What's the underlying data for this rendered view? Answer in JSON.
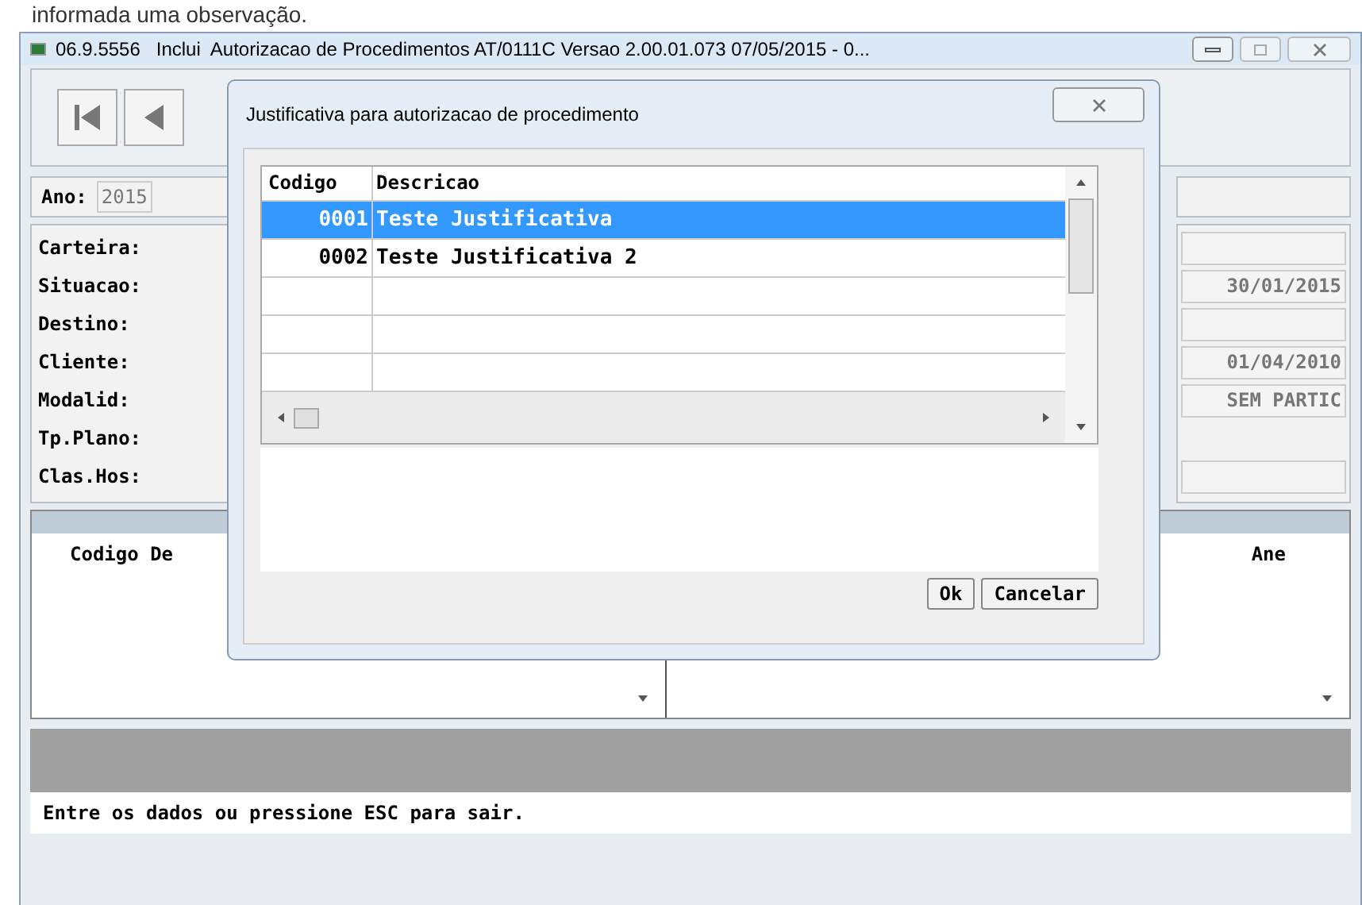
{
  "caption_fragment": "informada uma observação.",
  "window": {
    "title": "06.9.5556   Inclui  Autorizacao de Procedimentos AT/0111C Versao 2.00.01.073 07/05/2015 - 0..."
  },
  "form": {
    "ano_label": "Ano:",
    "ano_value": "2015",
    "rows": [
      {
        "label": "Carteira:",
        "kind": "field"
      },
      {
        "label": "Situacao:",
        "kind": "field",
        "value": "30/01/2015"
      },
      {
        "label": "Destino:",
        "kind": "field"
      },
      {
        "label": "Cliente:",
        "kind": "field",
        "value": "01/04/2010"
      },
      {
        "label": "Modalid:",
        "kind": "field",
        "value": "SEM PARTIC"
      },
      {
        "label": "Tp.Plano:",
        "kind": "label"
      },
      {
        "label": "Clas.Hos:",
        "kind": "field"
      }
    ]
  },
  "lists": {
    "left_header": "Codigo De",
    "right_header": "Ane"
  },
  "status_bar": "Entre os dados ou pressione ESC para sair.",
  "dialog": {
    "title": "Justificativa para autorizacao de procedimento",
    "columns": [
      "Codigo",
      "Descricao"
    ],
    "rows": [
      {
        "code": "0001",
        "description": "Teste Justificativa",
        "selected": true
      },
      {
        "code": "0002",
        "description": "Teste Justificativa 2",
        "selected": false
      }
    ],
    "buttons": [
      "Ok",
      "Cancelar"
    ]
  }
}
